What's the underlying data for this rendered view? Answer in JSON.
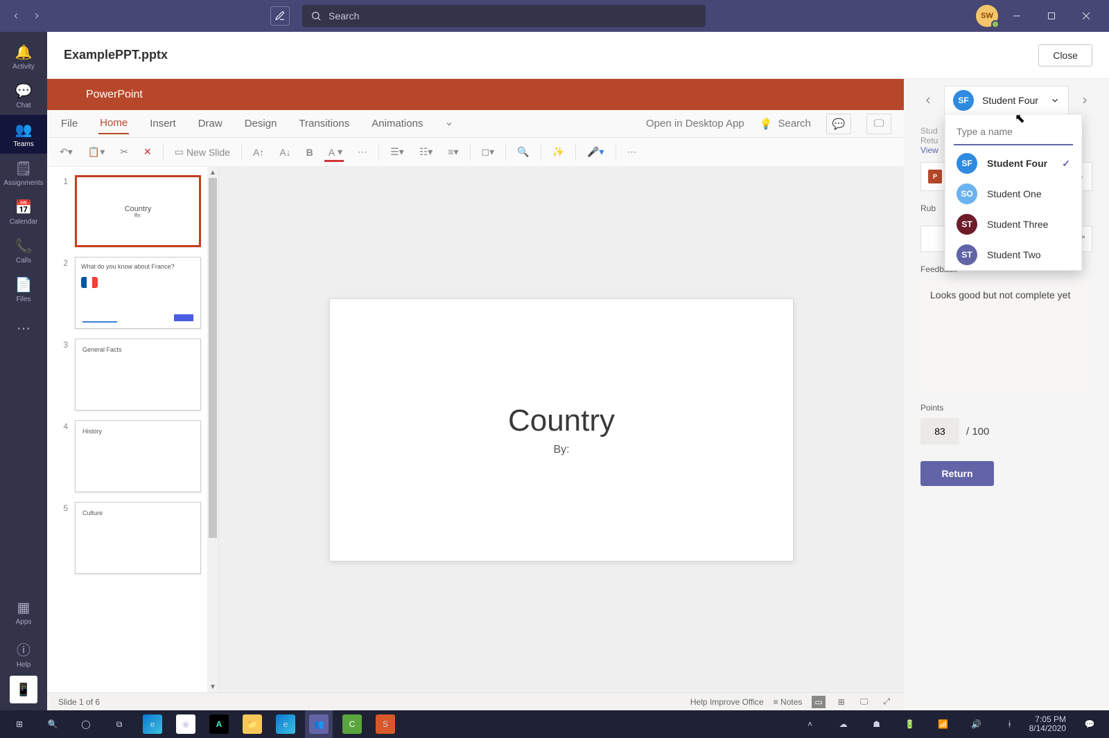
{
  "topbar": {
    "search_placeholder": "Search",
    "user_initials": "SW"
  },
  "rail": {
    "activity": "Activity",
    "chat": "Chat",
    "teams": "Teams",
    "assignments": "Assignments",
    "calendar": "Calendar",
    "calls": "Calls",
    "files": "Files",
    "apps": "Apps",
    "help": "Help"
  },
  "filebar": {
    "name": "ExamplePPT.pptx",
    "close": "Close"
  },
  "ppt": {
    "brand": "PowerPoint",
    "tabs": {
      "file": "File",
      "home": "Home",
      "insert": "Insert",
      "draw": "Draw",
      "design": "Design",
      "transitions": "Transitions",
      "animations": "Animations"
    },
    "open_desktop": "Open in Desktop App",
    "tell_search": "Search",
    "new_slide": "New Slide",
    "status_slide": "Slide 1 of 6",
    "status_improve": "Help Improve Office",
    "status_notes": "Notes",
    "slides": [
      {
        "num": "1",
        "title": "Country",
        "sub": "By:"
      },
      {
        "num": "2",
        "title": "What do you know about France?"
      },
      {
        "num": "3",
        "title": "General Facts"
      },
      {
        "num": "4",
        "title": "History"
      },
      {
        "num": "5",
        "title": "Culture"
      }
    ],
    "canvas": {
      "title": "Country",
      "sub": "By:"
    }
  },
  "grader": {
    "current_student": "Student Four",
    "dropdown_placeholder": "Type a name",
    "students": [
      {
        "initials": "SF",
        "name": "Student Four",
        "color": "blue",
        "selected": true
      },
      {
        "initials": "SO",
        "name": "Student One",
        "color": "sky"
      },
      {
        "initials": "ST",
        "name": "Student Three",
        "color": "maroon"
      },
      {
        "initials": "ST",
        "name": "Student Two",
        "color": "purple"
      }
    ],
    "labels": {
      "student_work_partial": "Stud",
      "returned_partial": "Retu",
      "view_partial": "View",
      "rubric_partial": "Rub",
      "feedback": "Feedback"
    },
    "feedback_text": "Looks good but not complete yet",
    "points_label": "Points",
    "points_value": "83",
    "points_max": "/ 100",
    "return": "Return"
  },
  "taskbar": {
    "time": "7:05 PM",
    "date": "8/14/2020"
  }
}
